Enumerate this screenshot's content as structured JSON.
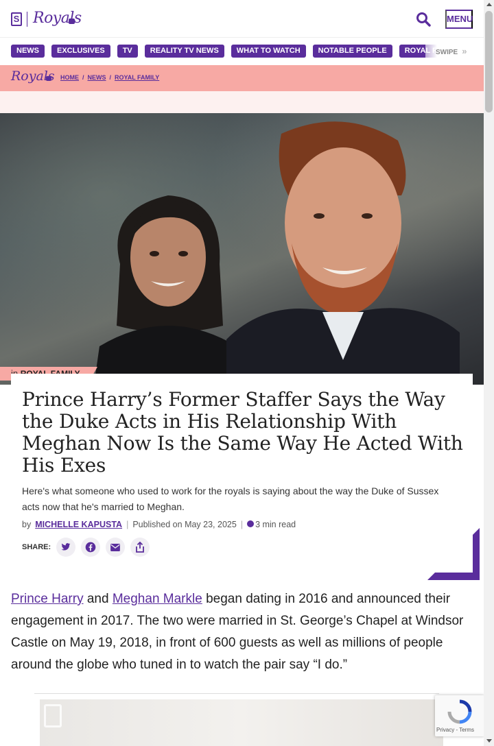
{
  "header": {
    "logo_letter": "S",
    "logo_text": "Royals",
    "menu_label": "MENU"
  },
  "nav": {
    "items": [
      "NEWS",
      "EXCLUSIVES",
      "TV",
      "REALITY TV NEWS",
      "WHAT TO WATCH",
      "NOTABLE PEOPLE",
      "ROYAL FAMILY"
    ],
    "swipe_label": "SWIPE"
  },
  "breadcrumb": {
    "logo_text": "Royals",
    "items": [
      "HOME",
      "NEWS",
      "ROYAL FAMILY"
    ]
  },
  "article": {
    "category_prefix": "in",
    "category": "ROYAL FAMILY",
    "headline": "Prince Harry’s Former Staffer Says the Way the Duke Acts in His Relationship With Meghan Now Is the Same Way He Acted With His Exes",
    "dek": "Here's what someone who used to work for the royals is saying about the way the Duke of Sussex acts now that he's married to Meghan.",
    "by_prefix": "by",
    "author": "MICHELLE KAPUSTA",
    "published": "Published on May 23, 2025",
    "read_time": "3 min read",
    "share_label": "SHARE:",
    "body": {
      "link1": "Prince Harry",
      "and": " and ",
      "link2": "Meghan Markle",
      "rest": " began dating in 2016 and announced their engagement in 2017. The two were married in St. George’s Chapel at Windsor Castle on May 19, 2018, in front of 600 guests as well as millions of people around the globe who tuned in to watch the pair say “I do.”"
    }
  },
  "recaptcha": {
    "text": "Privacy - Terms"
  },
  "colors": {
    "brand_purple": "#5a2d9c",
    "pink": "#f7a9a4"
  }
}
